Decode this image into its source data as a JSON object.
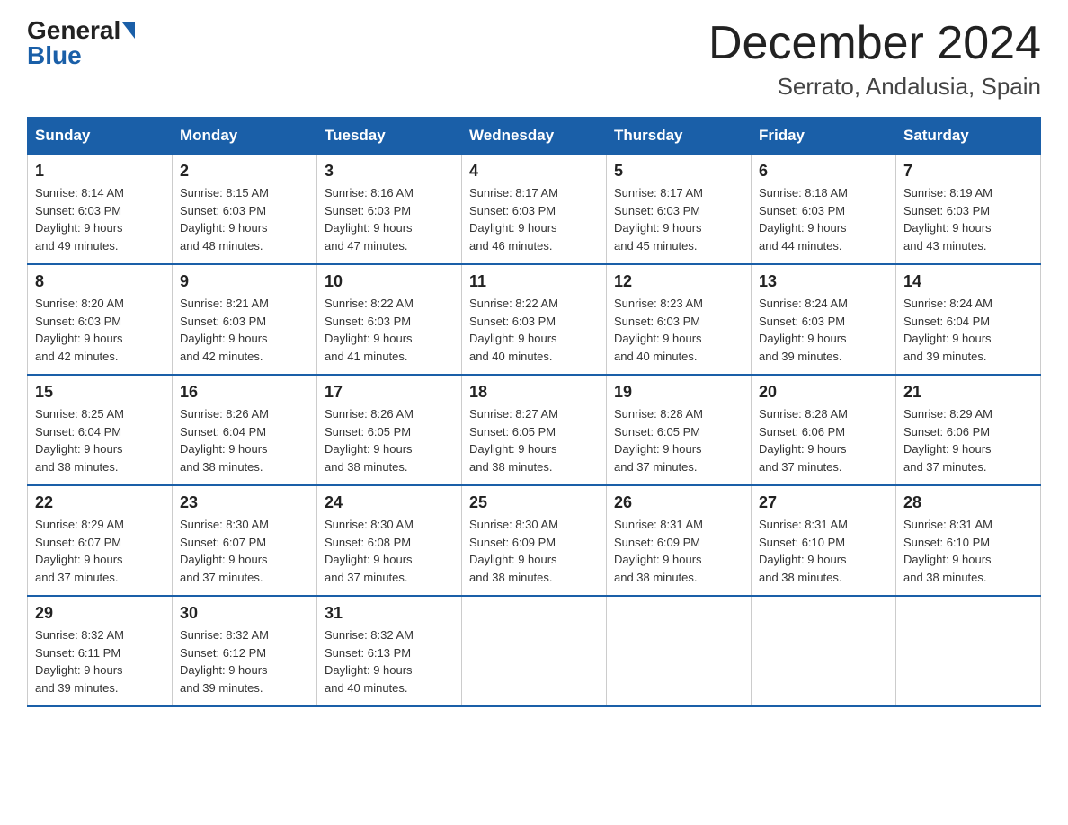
{
  "header": {
    "logo_general": "General",
    "logo_blue": "Blue",
    "title": "December 2024",
    "subtitle": "Serrato, Andalusia, Spain"
  },
  "calendar": {
    "days_of_week": [
      "Sunday",
      "Monday",
      "Tuesday",
      "Wednesday",
      "Thursday",
      "Friday",
      "Saturday"
    ],
    "weeks": [
      [
        {
          "day": "1",
          "sunrise": "8:14 AM",
          "sunset": "6:03 PM",
          "daylight": "9 hours and 49 minutes."
        },
        {
          "day": "2",
          "sunrise": "8:15 AM",
          "sunset": "6:03 PM",
          "daylight": "9 hours and 48 minutes."
        },
        {
          "day": "3",
          "sunrise": "8:16 AM",
          "sunset": "6:03 PM",
          "daylight": "9 hours and 47 minutes."
        },
        {
          "day": "4",
          "sunrise": "8:17 AM",
          "sunset": "6:03 PM",
          "daylight": "9 hours and 46 minutes."
        },
        {
          "day": "5",
          "sunrise": "8:17 AM",
          "sunset": "6:03 PM",
          "daylight": "9 hours and 45 minutes."
        },
        {
          "day": "6",
          "sunrise": "8:18 AM",
          "sunset": "6:03 PM",
          "daylight": "9 hours and 44 minutes."
        },
        {
          "day": "7",
          "sunrise": "8:19 AM",
          "sunset": "6:03 PM",
          "daylight": "9 hours and 43 minutes."
        }
      ],
      [
        {
          "day": "8",
          "sunrise": "8:20 AM",
          "sunset": "6:03 PM",
          "daylight": "9 hours and 42 minutes."
        },
        {
          "day": "9",
          "sunrise": "8:21 AM",
          "sunset": "6:03 PM",
          "daylight": "9 hours and 42 minutes."
        },
        {
          "day": "10",
          "sunrise": "8:22 AM",
          "sunset": "6:03 PM",
          "daylight": "9 hours and 41 minutes."
        },
        {
          "day": "11",
          "sunrise": "8:22 AM",
          "sunset": "6:03 PM",
          "daylight": "9 hours and 40 minutes."
        },
        {
          "day": "12",
          "sunrise": "8:23 AM",
          "sunset": "6:03 PM",
          "daylight": "9 hours and 40 minutes."
        },
        {
          "day": "13",
          "sunrise": "8:24 AM",
          "sunset": "6:03 PM",
          "daylight": "9 hours and 39 minutes."
        },
        {
          "day": "14",
          "sunrise": "8:24 AM",
          "sunset": "6:04 PM",
          "daylight": "9 hours and 39 minutes."
        }
      ],
      [
        {
          "day": "15",
          "sunrise": "8:25 AM",
          "sunset": "6:04 PM",
          "daylight": "9 hours and 38 minutes."
        },
        {
          "day": "16",
          "sunrise": "8:26 AM",
          "sunset": "6:04 PM",
          "daylight": "9 hours and 38 minutes."
        },
        {
          "day": "17",
          "sunrise": "8:26 AM",
          "sunset": "6:05 PM",
          "daylight": "9 hours and 38 minutes."
        },
        {
          "day": "18",
          "sunrise": "8:27 AM",
          "sunset": "6:05 PM",
          "daylight": "9 hours and 38 minutes."
        },
        {
          "day": "19",
          "sunrise": "8:28 AM",
          "sunset": "6:05 PM",
          "daylight": "9 hours and 37 minutes."
        },
        {
          "day": "20",
          "sunrise": "8:28 AM",
          "sunset": "6:06 PM",
          "daylight": "9 hours and 37 minutes."
        },
        {
          "day": "21",
          "sunrise": "8:29 AM",
          "sunset": "6:06 PM",
          "daylight": "9 hours and 37 minutes."
        }
      ],
      [
        {
          "day": "22",
          "sunrise": "8:29 AM",
          "sunset": "6:07 PM",
          "daylight": "9 hours and 37 minutes."
        },
        {
          "day": "23",
          "sunrise": "8:30 AM",
          "sunset": "6:07 PM",
          "daylight": "9 hours and 37 minutes."
        },
        {
          "day": "24",
          "sunrise": "8:30 AM",
          "sunset": "6:08 PM",
          "daylight": "9 hours and 37 minutes."
        },
        {
          "day": "25",
          "sunrise": "8:30 AM",
          "sunset": "6:09 PM",
          "daylight": "9 hours and 38 minutes."
        },
        {
          "day": "26",
          "sunrise": "8:31 AM",
          "sunset": "6:09 PM",
          "daylight": "9 hours and 38 minutes."
        },
        {
          "day": "27",
          "sunrise": "8:31 AM",
          "sunset": "6:10 PM",
          "daylight": "9 hours and 38 minutes."
        },
        {
          "day": "28",
          "sunrise": "8:31 AM",
          "sunset": "6:10 PM",
          "daylight": "9 hours and 38 minutes."
        }
      ],
      [
        {
          "day": "29",
          "sunrise": "8:32 AM",
          "sunset": "6:11 PM",
          "daylight": "9 hours and 39 minutes."
        },
        {
          "day": "30",
          "sunrise": "8:32 AM",
          "sunset": "6:12 PM",
          "daylight": "9 hours and 39 minutes."
        },
        {
          "day": "31",
          "sunrise": "8:32 AM",
          "sunset": "6:13 PM",
          "daylight": "9 hours and 40 minutes."
        },
        null,
        null,
        null,
        null
      ]
    ]
  }
}
